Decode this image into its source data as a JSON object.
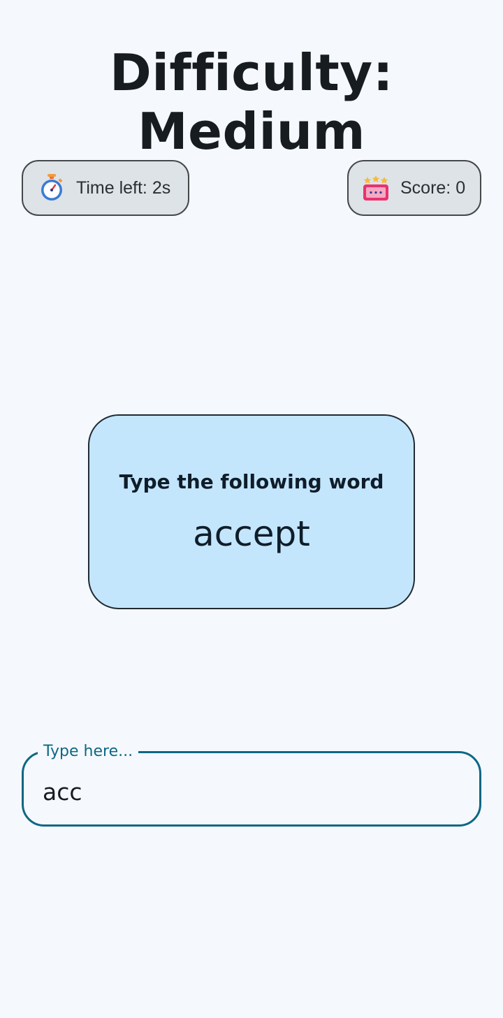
{
  "header": {
    "title": "Difficulty: Medium"
  },
  "status": {
    "timer": {
      "icon": "stopwatch-icon",
      "label": "Time left: 2s"
    },
    "score": {
      "icon": "score-board-icon",
      "label": "Score: 0"
    }
  },
  "card": {
    "prompt": "Type the following word",
    "word": "accept"
  },
  "input": {
    "label": "Type here...",
    "value": "acc"
  },
  "colors": {
    "background": "#f5f9fd",
    "chip_background": "#dee3e8",
    "card_background": "#c4e6fd",
    "accent": "#0e6785"
  }
}
